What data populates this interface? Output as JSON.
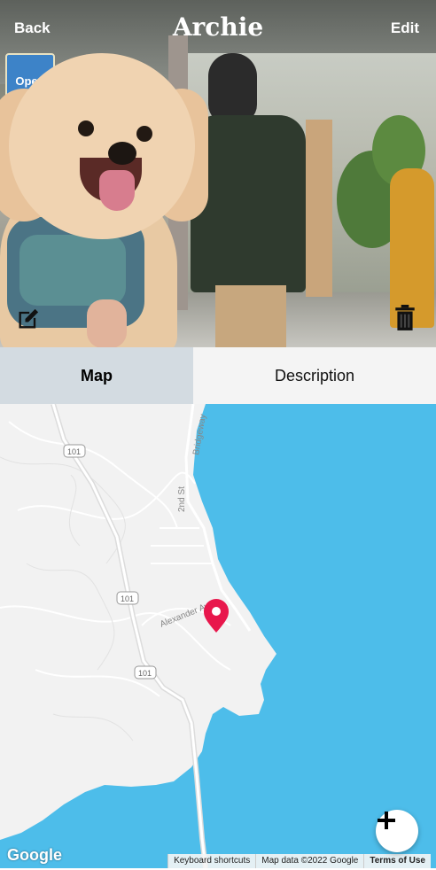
{
  "header": {
    "back_label": "Back",
    "title": "Archie",
    "edit_label": "Edit"
  },
  "photo": {
    "sign_text": "Open",
    "actions": [
      "edit-note-icon",
      "trash-icon"
    ]
  },
  "tabs": [
    {
      "label": "Map",
      "active": true
    },
    {
      "label": "Description",
      "active": false
    }
  ],
  "map": {
    "labels": {
      "road_101_a": "101",
      "road_101_b": "101",
      "road_101_c": "101",
      "bridgeway": "Bridgeway",
      "second_st": "2nd St",
      "alexander": "Alexander Ave"
    },
    "google_logo": "Google",
    "attribution": [
      "Keyboard shortcuts",
      "Map data ©2022 Google",
      "Terms of Use"
    ],
    "marker_color": "#e8174c",
    "water_color": "#4dbdea"
  },
  "fab_icon": "plus-icon"
}
